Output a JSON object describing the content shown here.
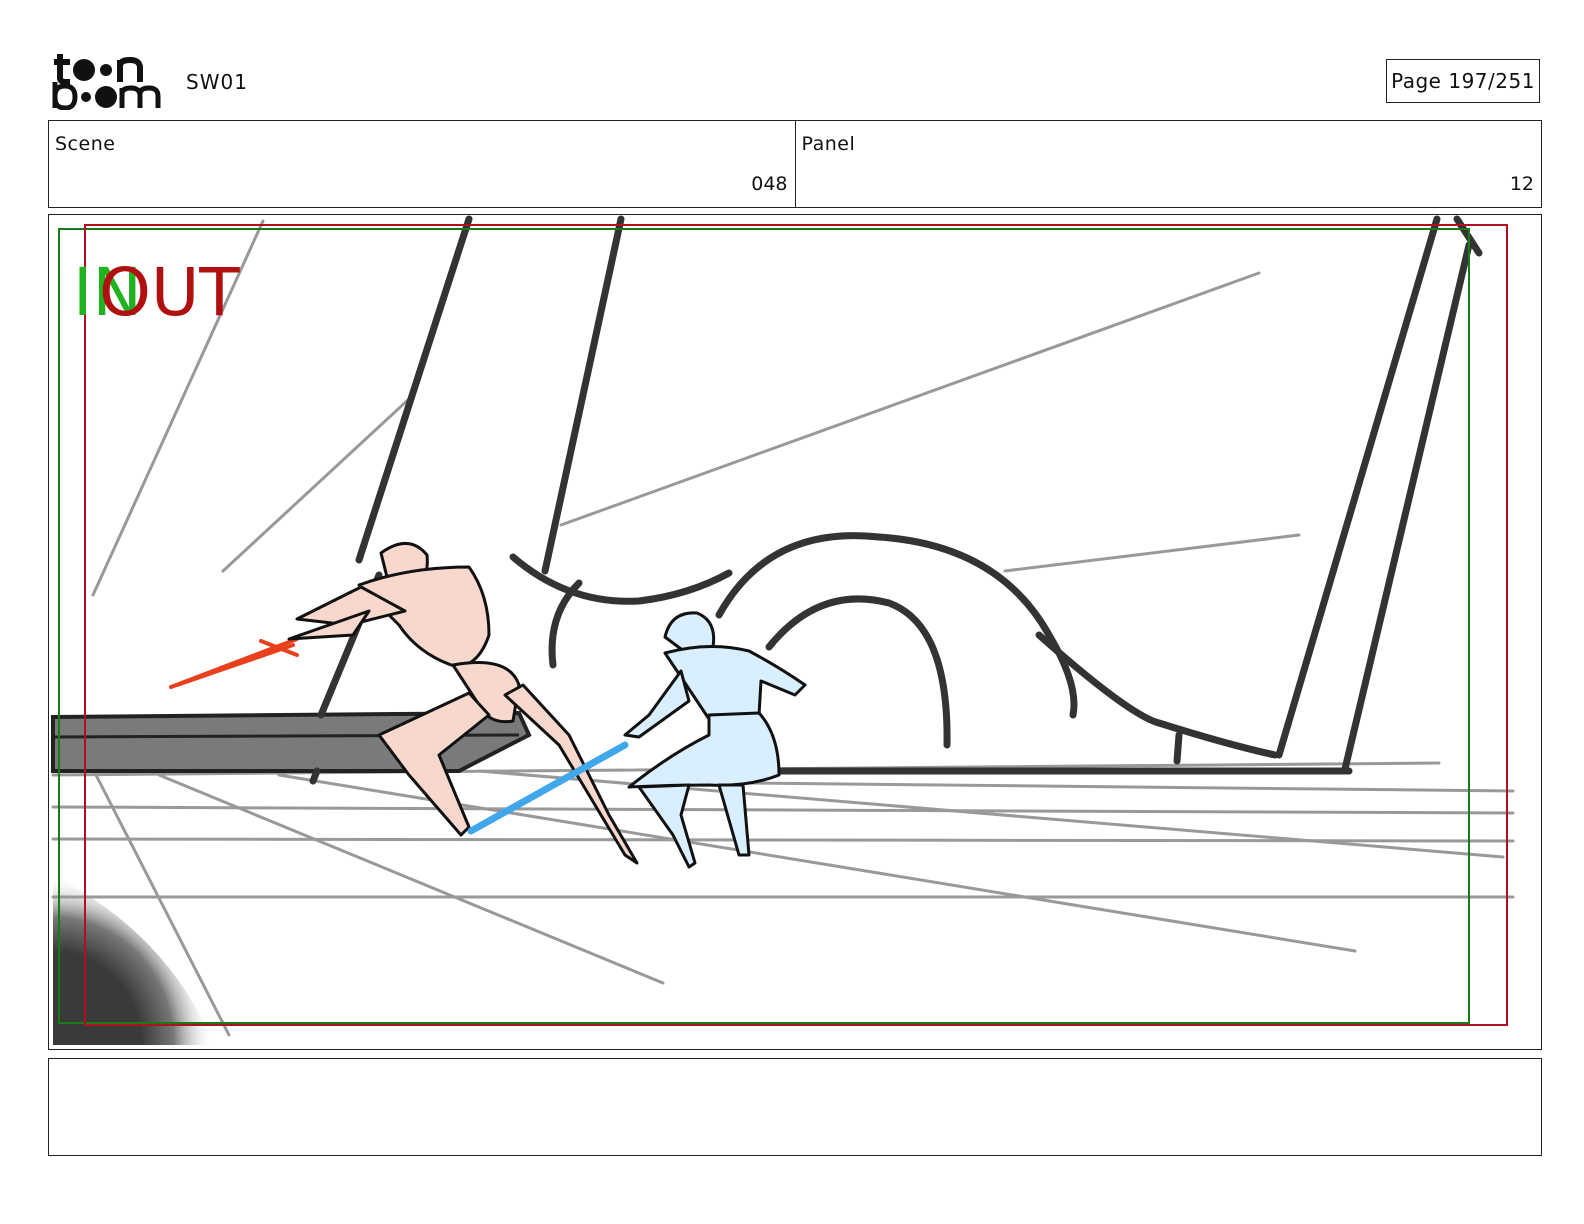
{
  "header": {
    "logo_text_top": "toon",
    "logo_text_bottom": "boom",
    "project": "SW01",
    "page_label": "Page 197/251"
  },
  "info": {
    "scene_label": "Scene",
    "scene_value": "048",
    "panel_label": "Panel",
    "panel_value": "12"
  },
  "frame": {
    "in_label": "IN",
    "out_label": "OUT",
    "in_color": "#1fb31f",
    "out_color": "#b01010"
  },
  "colors": {
    "red_saber": "#e8401c",
    "blue_saber": "#3fa7ea",
    "figure_left_fill": "#f8d8cc",
    "figure_right_fill": "#d9efff"
  },
  "notes": {
    "text": ""
  }
}
